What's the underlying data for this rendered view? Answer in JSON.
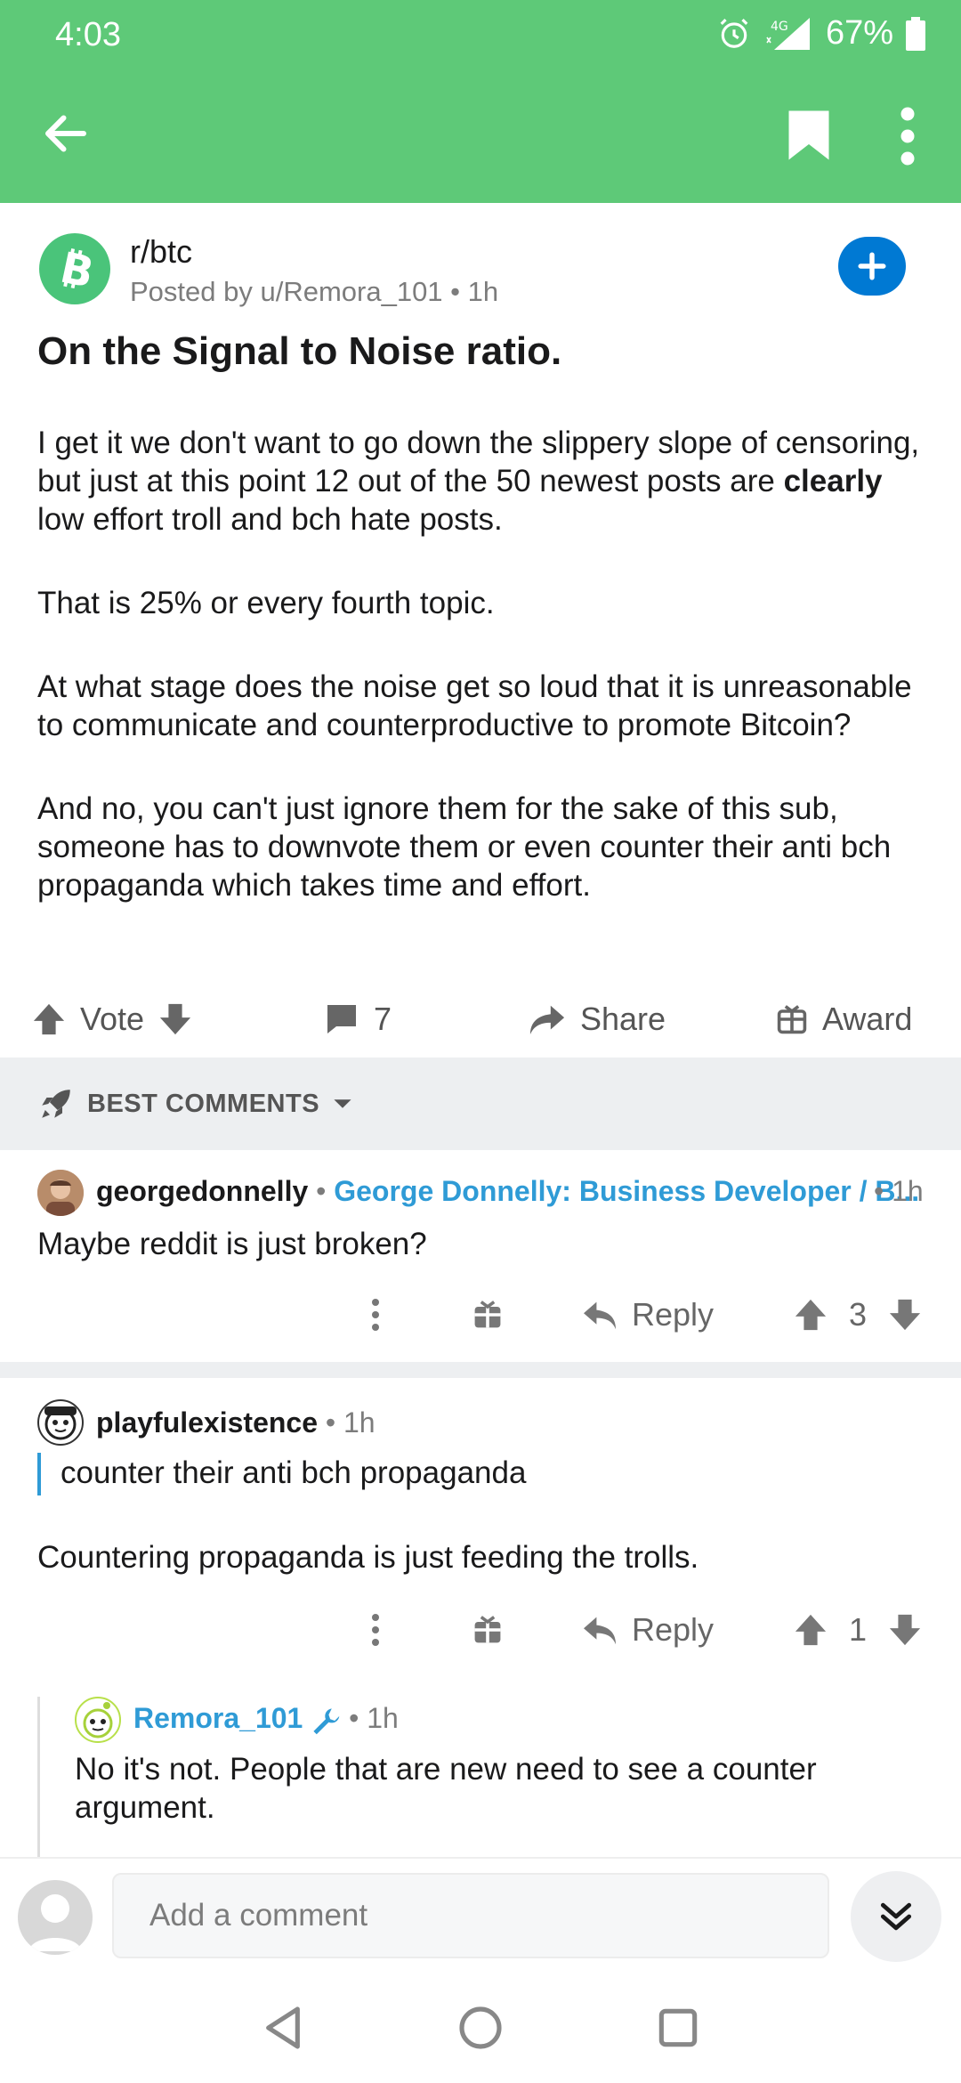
{
  "status": {
    "time": "4:03",
    "battery": "67%",
    "network": "4G"
  },
  "toolbar": {
    "back_icon": "arrow-left-icon",
    "bookmark_icon": "bookmark-icon",
    "more_icon": "more-vertical-icon"
  },
  "post": {
    "subreddit": "r/btc",
    "posted_by": "Posted by u/Remora_101 • 1h",
    "title": "On the Signal to Noise ratio.",
    "body": {
      "p1_before": "I get it we don't want to go down the slippery slope of censoring, but just at this point 12 out of the 50 newest posts are ",
      "p1_bold": "clearly",
      "p1_after": " low effort troll and bch hate posts.",
      "p2": "That is 25% or every fourth topic.",
      "p3": "At what stage does the noise get so loud that it is unreasonable to communicate and counterproductive to promote Bitcoin?",
      "p4": "And no, you can't just ignore them for the sake of this sub, someone has to downvote them or even counter their anti bch propaganda which takes time and effort."
    },
    "actions": {
      "vote": "Vote",
      "comments": "7",
      "share": "Share",
      "award": "Award"
    }
  },
  "sort": {
    "label": "BEST COMMENTS"
  },
  "comments": [
    {
      "user": "georgedonnelly",
      "flair": "George Donnelly: Business Developer / B...",
      "time": "• 1h",
      "text": "Maybe reddit is just broken?",
      "reply": "Reply",
      "score": "3"
    },
    {
      "user": "playfulexistence",
      "time": "• 1h",
      "quote": "counter their anti bch propaganda",
      "text": "Countering propaganda is just feeding the trolls.",
      "reply": "Reply",
      "score": "1"
    },
    {
      "user": "Remora_101",
      "time": "• 1h",
      "text": "No it's not. People that are new need to see a counter argument."
    }
  ],
  "composer": {
    "placeholder": "Add a comment"
  },
  "colors": {
    "header": "#5ec978",
    "accent": "#0079d3",
    "flair": "#2f9bd6"
  }
}
